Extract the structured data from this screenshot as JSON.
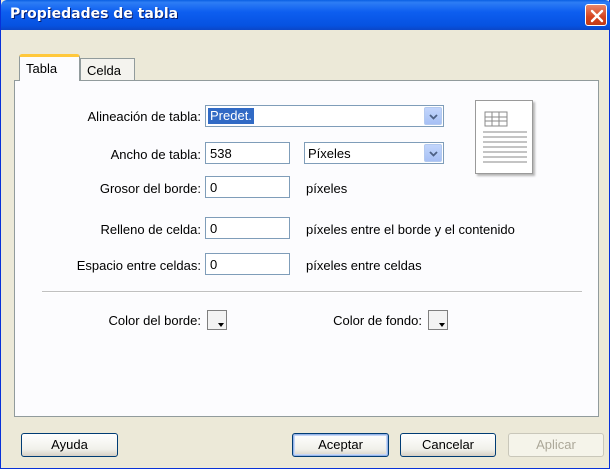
{
  "window": {
    "title": "Propiedades de tabla"
  },
  "tabs": [
    {
      "label": "Tabla",
      "active": true
    },
    {
      "label": "Celda",
      "active": false
    }
  ],
  "form": {
    "alineacion": {
      "label": "Alineación de tabla:",
      "value": "Predet."
    },
    "ancho": {
      "label": "Ancho de tabla:",
      "value": "538",
      "unit_value": "Píxeles"
    },
    "grosor": {
      "label": "Grosor del borde:",
      "value": "0",
      "suffix": "píxeles"
    },
    "relleno": {
      "label": "Relleno de celda:",
      "value": "0",
      "suffix": "píxeles entre el borde y el contenido"
    },
    "espacio": {
      "label": "Espacio entre celdas:",
      "value": "0",
      "suffix": "píxeles entre celdas"
    },
    "color_borde": {
      "label": "Color del borde:"
    },
    "color_fondo": {
      "label": "Color de fondo:"
    }
  },
  "buttons": {
    "ayuda": "Ayuda",
    "aceptar": "Aceptar",
    "cancelar": "Cancelar",
    "aplicar": "Aplicar"
  },
  "colors": {
    "titlebar": "#0a5fe3",
    "selection": "#316ac5",
    "tab_highlight": "#ffc83c"
  },
  "icons": [
    "close-icon",
    "dropdown-arrow-icon",
    "table-preview-icon",
    "color-picker-icon"
  ]
}
